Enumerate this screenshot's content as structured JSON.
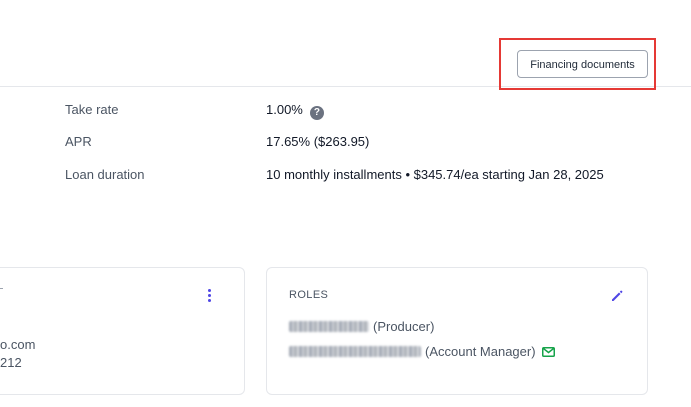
{
  "header": {
    "financing_button_label": "Financing documents"
  },
  "loan_details": {
    "take_rate": {
      "label": "Take rate",
      "value": "1.00%",
      "help": "?"
    },
    "apr": {
      "label": "APR",
      "value": "17.65% ($263.95)"
    },
    "loan_duration": {
      "label": "Loan duration",
      "value": "10 monthly installments • $345.74/ea starting Jan 28, 2025"
    }
  },
  "left_card": {
    "email_fragment": "o.com",
    "phone_fragment": "212"
  },
  "roles_card": {
    "title": "ROLES",
    "roles": [
      {
        "role": "(Producer)"
      },
      {
        "role": "(Account Manager)"
      }
    ]
  },
  "colors": {
    "accent": "#4f46e5",
    "mail_icon": "#16a34a",
    "highlight": "#e53935"
  }
}
